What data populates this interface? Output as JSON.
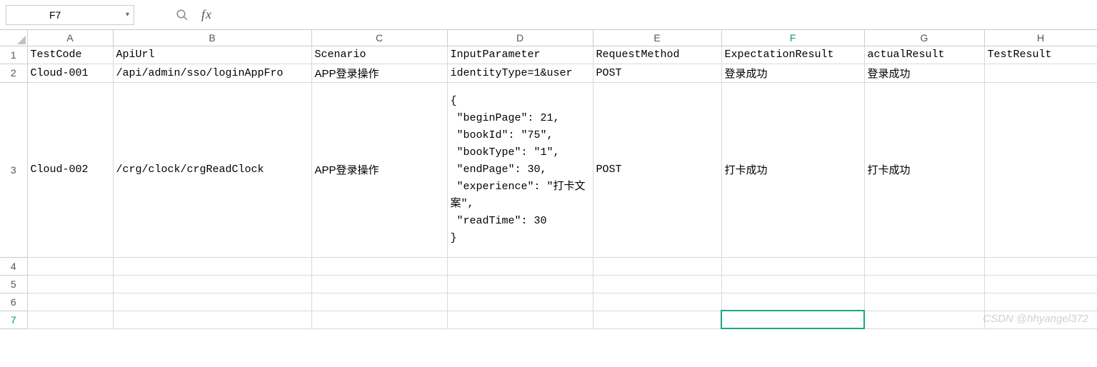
{
  "formula_bar": {
    "cell_ref": "F7",
    "fx_label": "fx",
    "formula_value": ""
  },
  "columns": {
    "A": "A",
    "B": "B",
    "C": "C",
    "D": "D",
    "E": "E",
    "F": "F",
    "G": "G",
    "H": "H"
  },
  "rows": {
    "r1": "1",
    "r2": "2",
    "r3": "3",
    "r4": "4",
    "r5": "5",
    "r6": "6",
    "r7": "7"
  },
  "headers": {
    "TestCode": "TestCode",
    "ApiUrl": "ApiUrl",
    "Scenario": "Scenario",
    "InputParameter": "InputParameter",
    "RequestMethod": "RequestMethod",
    "ExpectationResult": "ExpectationResult",
    "actualResult": "actualResult",
    "TestResult": "TestResult"
  },
  "data": {
    "row2": {
      "TestCode": "Cloud-001",
      "ApiUrl": "/api/admin/sso/loginAppFro",
      "Scenario": "APP登录操作",
      "InputParameter": "identityType=1&user",
      "RequestMethod": "POST",
      "ExpectationResult": "登录成功",
      "actualResult": "登录成功",
      "TestResult": ""
    },
    "row3": {
      "TestCode": "Cloud-002",
      "ApiUrl": "/crg/clock/crgReadClock",
      "Scenario": "APP登录操作",
      "InputParameter": "{\n \"beginPage\": 21,\n \"bookId\": \"75\",\n \"bookType\": \"1\",\n \"endPage\": 30,\n \"experience\": \"打卡文案\",\n \"readTime\": 30\n}",
      "RequestMethod": "POST",
      "ExpectationResult": "打卡成功",
      "actualResult": "打卡成功",
      "TestResult": ""
    }
  },
  "watermark": "CSDN @hhyangel372"
}
